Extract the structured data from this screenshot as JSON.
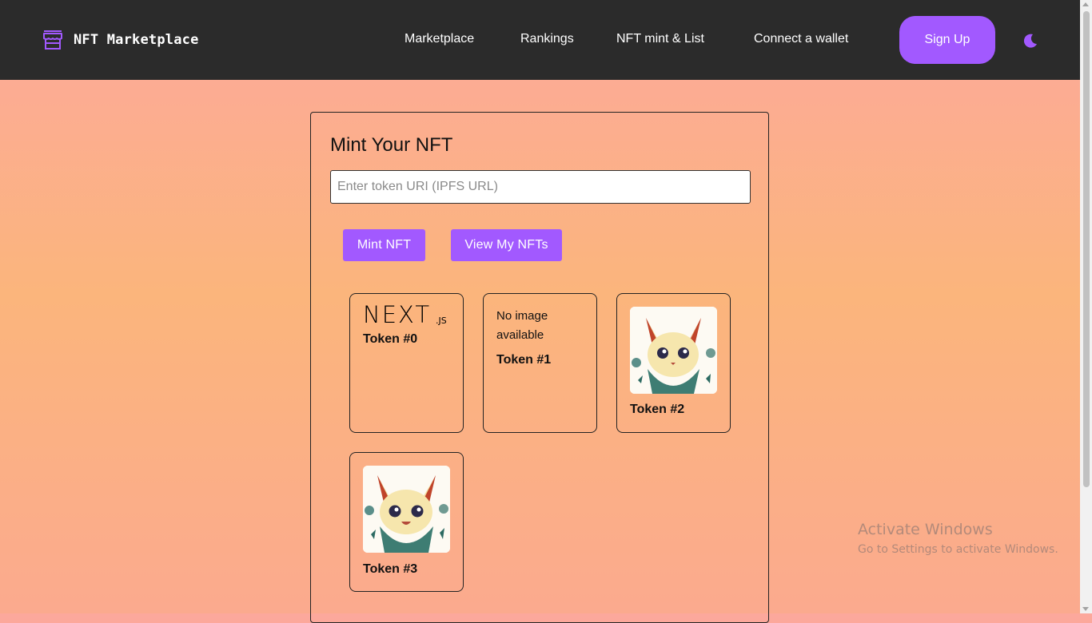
{
  "header": {
    "brand": "NFT Marketplace",
    "brand_icon": "storefront-icon",
    "nav": [
      "Marketplace",
      "Rankings",
      "NFT mint & List",
      "Connect a wallet"
    ],
    "signup_label": "Sign Up",
    "theme_icon": "moon-icon",
    "accent_color": "#a259ff",
    "bar_color": "#2b2b2b"
  },
  "mint": {
    "title": "Mint Your NFT",
    "input_placeholder": "Enter token URI (IPFS URL)",
    "input_value": "",
    "mint_label": "Mint NFT",
    "view_label": "View My NFTs"
  },
  "tokens": [
    {
      "label": "Token #0",
      "image": "nextjs-logo"
    },
    {
      "label": "Token #1",
      "image": "none",
      "no_image_text": "No image available"
    },
    {
      "label": "Token #2",
      "image": "cat-illustration"
    },
    {
      "label": "Token #3",
      "image": "cat-illustration"
    }
  ],
  "nextjs_logo_text": {
    "main": "NEXT",
    "suffix": ".JS"
  },
  "watermark": {
    "line1": "Activate Windows",
    "line2": "Go to Settings to activate Windows."
  }
}
